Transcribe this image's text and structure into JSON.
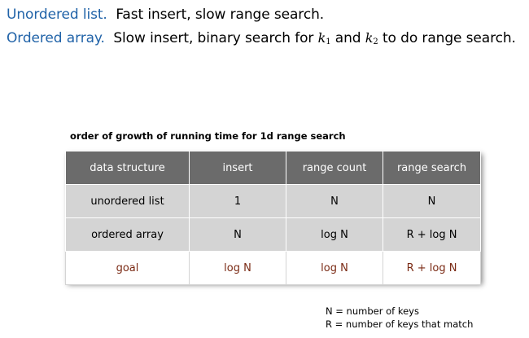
{
  "intro": {
    "line1": {
      "term": "Unordered list.",
      "text": "Fast insert, slow range search."
    },
    "line2": {
      "term": "Ordered array.",
      "text_a": "Slow insert, binary search for",
      "k1_base": "k",
      "k1_sub": "1",
      "and": "and",
      "k2_base": "k",
      "k2_sub": "2",
      "text_b": "to do range search."
    }
  },
  "table": {
    "caption": "order of growth of running time for 1d range search",
    "headers": [
      "data structure",
      "insert",
      "range count",
      "range search"
    ],
    "rows": [
      [
        "unordered list",
        "1",
        "N",
        "N"
      ],
      [
        "ordered array",
        "N",
        "log N",
        "R + log N"
      ],
      [
        "goal",
        "log N",
        "log N",
        "R + log N"
      ]
    ]
  },
  "legend": {
    "n": "N = number of keys",
    "r": "R = number of keys that match"
  },
  "colors": {
    "term_blue": "#2163a8",
    "header_bg": "#6b6b6b",
    "row_bg": "#d4d4d4",
    "goal_text": "#7a2a14"
  }
}
